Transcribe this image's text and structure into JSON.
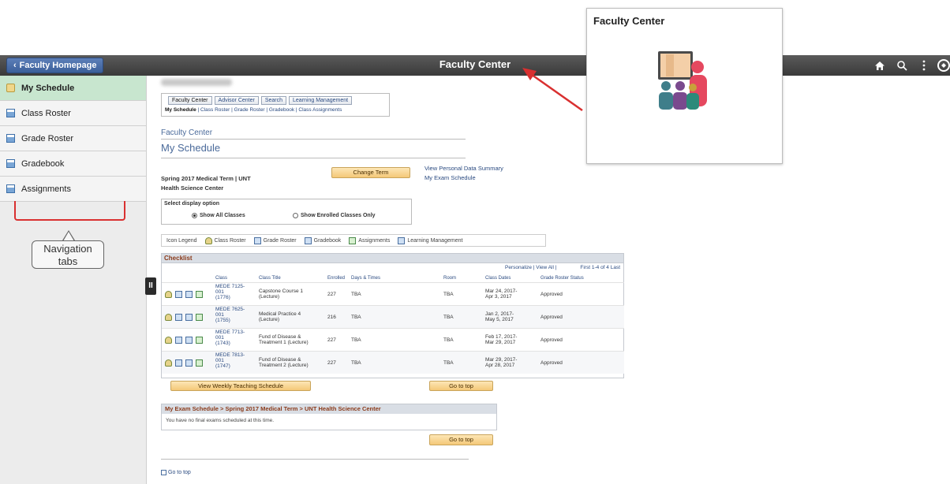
{
  "topbar": {
    "back_label": "Faculty Homepage",
    "title": "Faculty Center",
    "icons": [
      "home-icon",
      "search-icon",
      "more-vertical-icon",
      "navbar-icon"
    ]
  },
  "sidebar": {
    "items": [
      {
        "label": "My Schedule",
        "icon": "schedule-icon",
        "active": true
      },
      {
        "label": "Class Roster",
        "icon": "roster-icon",
        "active": false
      },
      {
        "label": "Grade Roster",
        "icon": "grade-icon",
        "active": false
      },
      {
        "label": "Gradebook",
        "icon": "gradebook-icon",
        "active": false
      },
      {
        "label": "Assignments",
        "icon": "assignments-icon",
        "active": false
      }
    ],
    "callout": [
      "Navigation",
      "tabs"
    ],
    "collapse_glyph": "II"
  },
  "tabs": [
    "Faculty Center",
    "Advisor Center",
    "Search",
    "Learning Management"
  ],
  "sublinks": [
    "My Schedule",
    "Class Roster",
    "Grade Roster",
    "Gradebook",
    "Class Assignments"
  ],
  "main": {
    "section_label": "Faculty Center",
    "title": "My Schedule",
    "term_line1": "Spring 2017 Medical Term | UNT",
    "term_line2": "Health Science Center",
    "change_term": "Change Term",
    "links": [
      "View Personal Data Summary",
      "My Exam Schedule"
    ],
    "display_title": "Select display option",
    "radio_all": "Show All Classes",
    "radio_enrolled": "Show Enrolled Classes Only",
    "legend": [
      "Icon Legend",
      "Class Roster",
      "Grade Roster",
      "Gradebook",
      "Assignments",
      "Learning Management"
    ]
  },
  "checklist": {
    "title": "Checklist",
    "tools": "Personalize | View All |",
    "pagination": "First 1-4 of 4 Last",
    "columns": [
      "Class",
      "Class Title",
      "Enrolled",
      "Days & Times",
      "Room",
      "Class Dates",
      "Grade Roster Status"
    ],
    "rows": [
      {
        "class": [
          "MEDE 7125-",
          "001",
          "(1776)"
        ],
        "title": [
          "Capstone Course 1",
          "(Lecture)"
        ],
        "enrolled": "227",
        "days": "TBA",
        "room": "TBA",
        "dates": [
          "Mar 24, 2017-",
          "Apr 3, 2017"
        ],
        "status": "Approved"
      },
      {
        "class": [
          "MEDE 7625-",
          "001",
          "(1755)"
        ],
        "title": [
          "Medical Practice 4",
          "(Lecture)"
        ],
        "enrolled": "216",
        "days": "TBA",
        "room": "TBA",
        "dates": [
          "Jan 2, 2017-",
          "May 5, 2017"
        ],
        "status": "Approved"
      },
      {
        "class": [
          "MEDE 7713-",
          "001",
          "(1743)"
        ],
        "title": [
          "Fund of Disease &",
          "Treatment 1 (Lecture)"
        ],
        "enrolled": "227",
        "days": "TBA",
        "room": "TBA",
        "dates": [
          "Feb 17, 2017-",
          "Mar 29, 2017"
        ],
        "status": "Approved"
      },
      {
        "class": [
          "MEDE 7813-",
          "001",
          "(1747)"
        ],
        "title": [
          "Fund of Disease &",
          "Treatment 2 (Lecture)"
        ],
        "enrolled": "227",
        "days": "TBA",
        "room": "TBA",
        "dates": [
          "Mar 29, 2017-",
          "Apr 28, 2017"
        ],
        "status": "Approved"
      }
    ],
    "weekly_button": "View Weekly Teaching Schedule",
    "go_top": "Go to top"
  },
  "exam": {
    "header": "My Exam Schedule > Spring 2017 Medical Term > UNT Health Science Center",
    "message": "You have no final exams scheduled at this time.",
    "go_top": "Go to top"
  },
  "bottom_link": "Go to top",
  "tile": {
    "title": "Faculty Center",
    "icon": "faculty-people-icon"
  },
  "colors": {
    "topbar": "#3a3a3a",
    "back_button": "#3b5f9a",
    "active_sidebar": "#c8e6cf",
    "highlight_red": "#d93030",
    "button_orange": "#f4c878"
  }
}
